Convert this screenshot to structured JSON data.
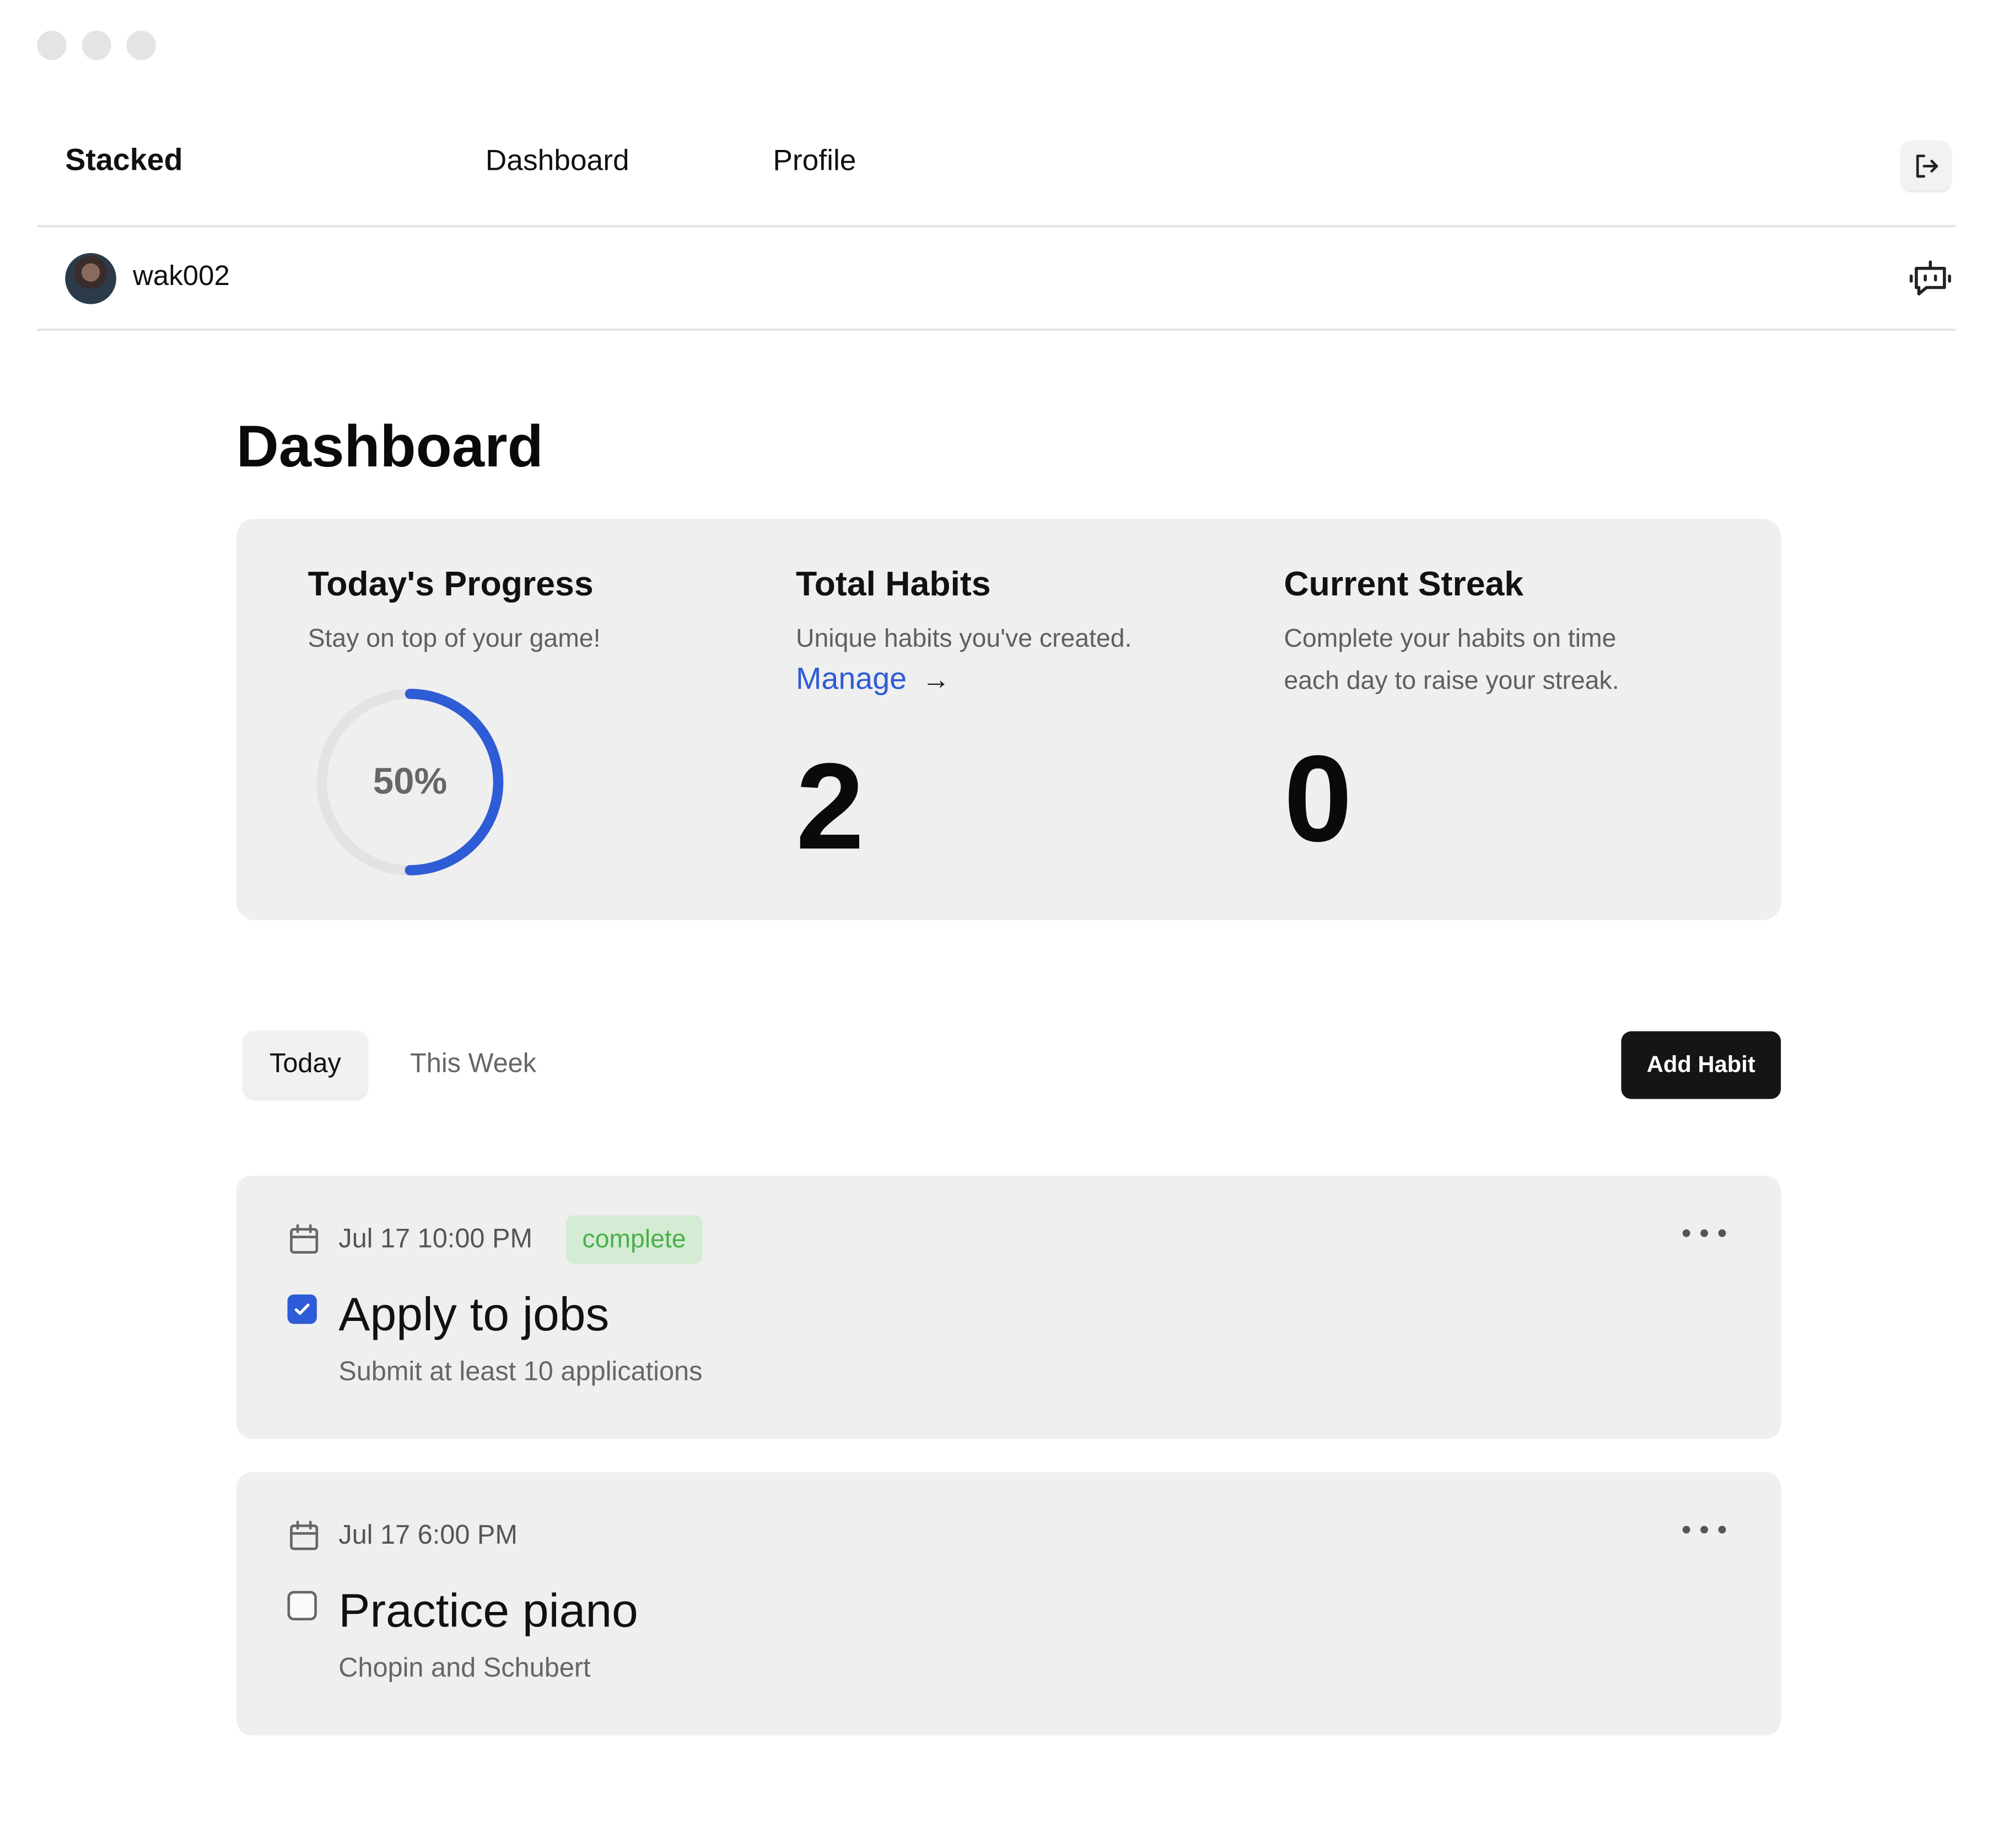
{
  "window": {
    "controls": [
      "close",
      "minimize",
      "maximize"
    ]
  },
  "nav": {
    "brand": "Stacked",
    "links": [
      {
        "label": "Dashboard"
      },
      {
        "label": "Profile"
      }
    ],
    "logout_icon": "logout-icon"
  },
  "user": {
    "username": "wak002",
    "assistant_icon": "bot-icon"
  },
  "page": {
    "title": "Dashboard"
  },
  "stats": {
    "progress": {
      "title": "Today's Progress",
      "description": "Stay on top of your game!",
      "percent_label": "50%",
      "percent_value": 0.5,
      "ring_color": "#2e5bd6"
    },
    "total_habits": {
      "title": "Total Habits",
      "description": "Unique habits you've created.",
      "link_label": "Manage",
      "link_arrow": "→",
      "value": "2"
    },
    "streak": {
      "title": "Current Streak",
      "description_line1": "Complete your habits on time",
      "description_line2": "each day to raise your streak.",
      "value": "0"
    }
  },
  "tabs": {
    "today": "Today",
    "this_week": "This Week",
    "active": "today"
  },
  "actions": {
    "add_habit": "Add Habit"
  },
  "habits": [
    {
      "datetime": "Jul 17 10:00 PM",
      "status": "complete",
      "checked": true,
      "name": "Apply to jobs",
      "description": "Submit at least 10 applications"
    },
    {
      "datetime": "Jul 17 6:00 PM",
      "status": "",
      "checked": false,
      "name": "Practice piano",
      "description": "Chopin and Schubert"
    }
  ],
  "colors": {
    "accent": "#2e5bd6",
    "badge_bg": "#d4ecd4",
    "badge_text": "#4bb04b",
    "card_bg": "#efefef",
    "primary_button": "#151515"
  }
}
